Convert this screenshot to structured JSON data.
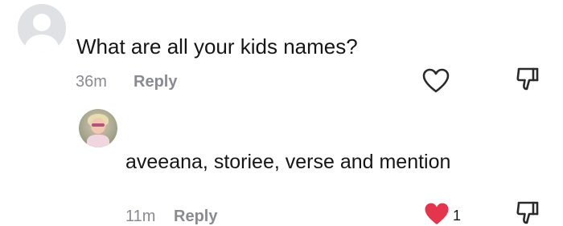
{
  "thread": {
    "comment": {
      "text": "What are all your kids names?",
      "time": "36m",
      "reply_label": "Reply",
      "liked": false
    },
    "reply": {
      "text": "aveeana, storiee, verse and mention",
      "time": "11m",
      "reply_label": "Reply",
      "liked": true,
      "like_count": "1",
      "like_color": "#e5354d"
    }
  },
  "icons": {
    "default_avatar": "user-avatar-placeholder",
    "reply_avatar": "child-with-sunglasses-photo",
    "heart_outline": "heart-outline-icon",
    "heart_filled": "heart-filled-icon",
    "dislike": "thumbs-down-icon"
  }
}
